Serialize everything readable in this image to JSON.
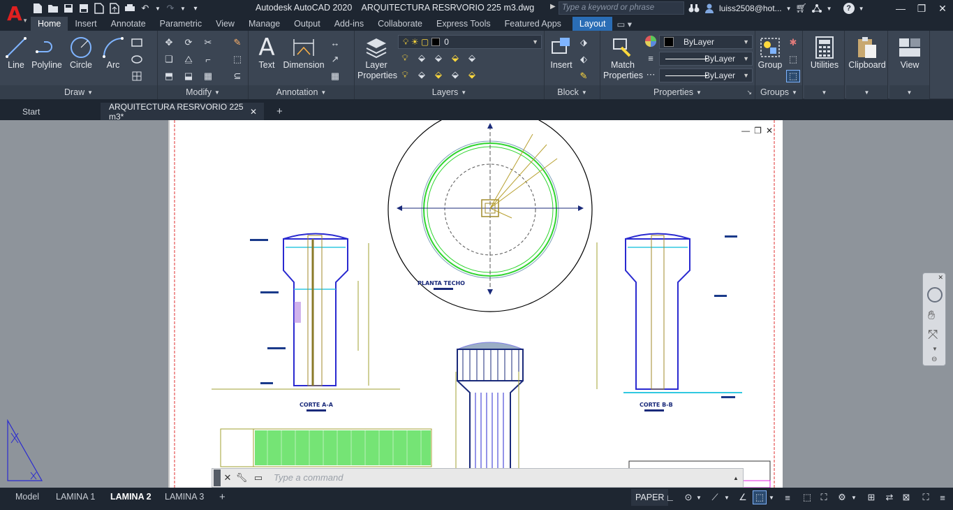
{
  "titlebar": {
    "app_title": "Autodesk AutoCAD 2020",
    "document": "ARQUITECTURA RESRVORIO 225 m3.dwg",
    "search_placeholder": "Type a keyword or phrase",
    "user": "luiss2508@hot..."
  },
  "ribbon_tabs": [
    "Home",
    "Insert",
    "Annotate",
    "Parametric",
    "View",
    "Manage",
    "Output",
    "Add-ins",
    "Collaborate",
    "Express Tools",
    "Featured Apps",
    "Layout"
  ],
  "ribbon": {
    "draw": {
      "title": "Draw",
      "line": "Line",
      "polyline": "Polyline",
      "circle": "Circle",
      "arc": "Arc"
    },
    "modify": {
      "title": "Modify"
    },
    "annotation": {
      "title": "Annotation",
      "text": "Text",
      "dimension": "Dimension"
    },
    "layers": {
      "title": "Layers",
      "layer_properties": "Layer Properties",
      "current_layer": "0"
    },
    "block": {
      "title": "Block",
      "insert": "Insert"
    },
    "properties": {
      "title": "Properties",
      "match": "Match Properties",
      "color": "ByLayer",
      "linetype": "ByLayer",
      "lineweight": "ByLayer"
    },
    "groups": {
      "title": "Groups",
      "group": "Group"
    },
    "utilities": "Utilities",
    "clipboard": "Clipboard",
    "view": "View"
  },
  "file_tabs": {
    "start": "Start",
    "active": "ARQUITECTURA RESRVORIO 225 m3*"
  },
  "drawing": {
    "labels": {
      "planta": "PLANTA TECHO",
      "corte_a": "CORTE A-A",
      "corte_b": "CORTE B-B"
    }
  },
  "command": {
    "placeholder": "Type a command"
  },
  "layout_tabs": [
    "Model",
    "LAMINA 1",
    "LAMINA 2",
    "LAMINA 3"
  ],
  "active_layout": "LAMINA 2",
  "status": {
    "space": "PAPER"
  }
}
